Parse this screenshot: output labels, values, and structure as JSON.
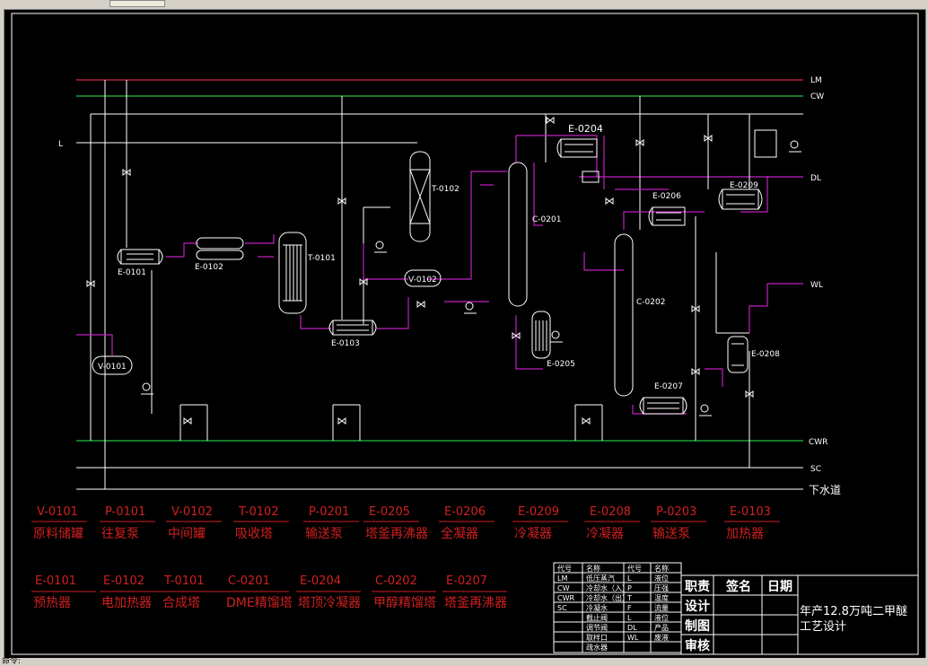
{
  "status": {
    "text": "命令:"
  },
  "utility_lines": {
    "lm": "LM",
    "cw": "CW",
    "l": "L",
    "dl": "DL",
    "wl": "WL",
    "cwr": "CWR",
    "sc": "SC",
    "drain": "下水道"
  },
  "equipment_labels": {
    "e0101": "E-0101",
    "e0102": "E-0102",
    "t0101": "T-0101",
    "t0102": "T-0102",
    "v0101": "V-0101",
    "v0102": "V-0102",
    "e0103": "E-0103",
    "c0201": "C-0201",
    "e0204": "E-0204",
    "e0205": "E-0205",
    "e0206": "E-0206",
    "c0202": "C-0202",
    "e0207": "E-0207",
    "e0208": "E-0208",
    "e0209": "E-0209"
  },
  "legend_row1": [
    {
      "tag": "V-0101",
      "name": "原料储罐"
    },
    {
      "tag": "P-0101",
      "name": "往复泵"
    },
    {
      "tag": "V-0102",
      "name": "中间罐"
    },
    {
      "tag": "T-0102",
      "name": "吸收塔"
    },
    {
      "tag": "P-0201",
      "name": "输送泵"
    },
    {
      "tag": "E-0205",
      "name": "塔釜再沸器"
    },
    {
      "tag": "E-0206",
      "name": "全凝器"
    },
    {
      "tag": "E-0209",
      "name": "冷凝器"
    },
    {
      "tag": "E-0208",
      "name": "冷凝器"
    },
    {
      "tag": "P-0203",
      "name": "输送泵"
    },
    {
      "tag": "E-0103",
      "name": "加热器"
    }
  ],
  "legend_row2": [
    {
      "tag": "E-0101",
      "name": "预热器"
    },
    {
      "tag": "E-0102",
      "name": "电加热器"
    },
    {
      "tag": "T-0101",
      "name": "合成塔"
    },
    {
      "tag": "C-0201",
      "name": "DME精馏塔"
    },
    {
      "tag": "E-0204",
      "name": "塔顶冷凝器"
    },
    {
      "tag": "C-0202",
      "name": "甲醇精馏塔"
    },
    {
      "tag": "E-0207",
      "name": "塔釜再沸器"
    }
  ],
  "symbol_table": {
    "headers": [
      "代号",
      "名称",
      "代号",
      "名称"
    ],
    "rows": [
      [
        "LM",
        "低压蒸汽",
        "L",
        "液位"
      ],
      [
        "CW",
        "冷却水（入）",
        "P",
        "压强"
      ],
      [
        "CWR",
        "冷却水（出）",
        "T",
        "温度"
      ],
      [
        "SC",
        "冷凝水",
        "F",
        "流量"
      ],
      [
        "",
        "截止阀",
        "L",
        "液位"
      ],
      [
        "",
        "调节阀",
        "DL",
        "产品"
      ],
      [
        "",
        "取样口",
        "WL",
        "废液"
      ],
      [
        "",
        "疏水器",
        "",
        ""
      ]
    ]
  },
  "title_block": {
    "roles": [
      "职责",
      "设计",
      "制图",
      "审核"
    ],
    "sign": "签名",
    "date": "日期",
    "title_line1": "年产12.8万吨二甲醚",
    "title_line2": "工艺设计"
  },
  "colors": {
    "lm_line": "#b0203a",
    "cw_line": "#20c040",
    "process_line": "#c020c0",
    "drawing_line": "#ffffff",
    "legend_text": "#d02020",
    "background": "#000000"
  }
}
